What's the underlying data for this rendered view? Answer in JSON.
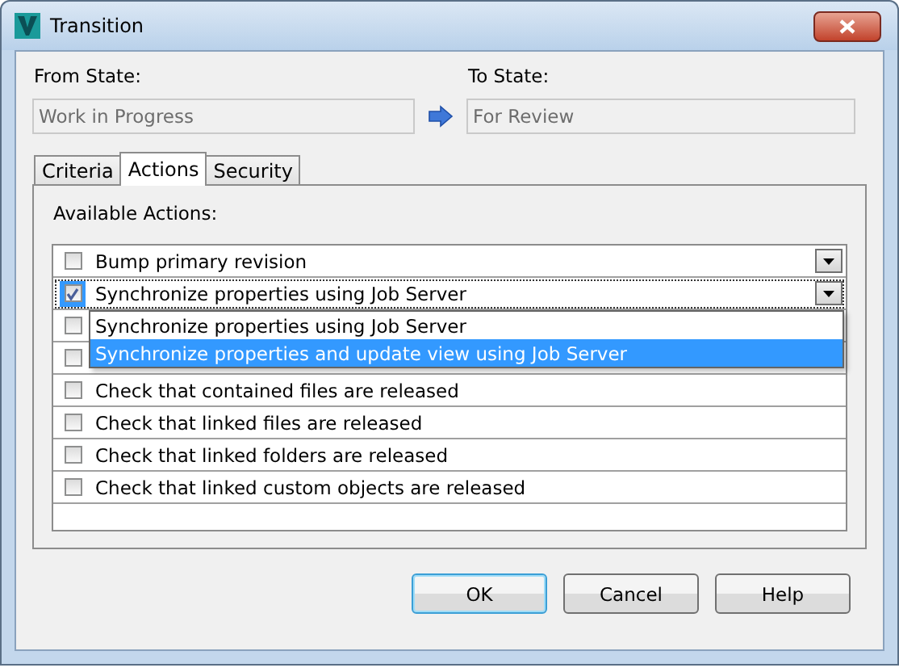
{
  "window": {
    "title": "Transition"
  },
  "from_state": {
    "label": "From State:",
    "value": "Work in Progress"
  },
  "to_state": {
    "label": "To State:",
    "value": "For Review"
  },
  "tabs": [
    {
      "label": "Criteria",
      "selected": false
    },
    {
      "label": "Actions",
      "selected": true
    },
    {
      "label": "Security",
      "selected": false
    }
  ],
  "available_actions": {
    "label": "Available Actions:",
    "rows": [
      {
        "kind": "dropdown",
        "label": "Bump primary revision",
        "checked": false,
        "selected": false
      },
      {
        "kind": "dropdown",
        "label": "Synchronize properties using Job Server",
        "checked": true,
        "selected": true
      },
      {
        "kind": "check",
        "checked": false,
        "selected": false
      },
      {
        "kind": "check",
        "checked": false,
        "selected": false
      },
      {
        "kind": "check",
        "label": "Check that contained files are released",
        "checked": false,
        "selected": false
      },
      {
        "kind": "check",
        "label": "Check that linked files are released",
        "checked": false,
        "selected": false
      },
      {
        "kind": "check",
        "label": "Check that linked folders are released",
        "checked": false,
        "selected": false
      },
      {
        "kind": "check",
        "label": "Check that linked custom objects are released",
        "checked": false,
        "selected": false
      }
    ],
    "dropdown_options": [
      {
        "label": "Synchronize properties using Job Server",
        "selected": false
      },
      {
        "label": "Synchronize properties and update view using Job Server",
        "selected": true
      }
    ]
  },
  "buttons": [
    {
      "label": "OK",
      "default": true
    },
    {
      "label": "Cancel",
      "default": false
    },
    {
      "label": "Help",
      "default": false
    }
  ]
}
